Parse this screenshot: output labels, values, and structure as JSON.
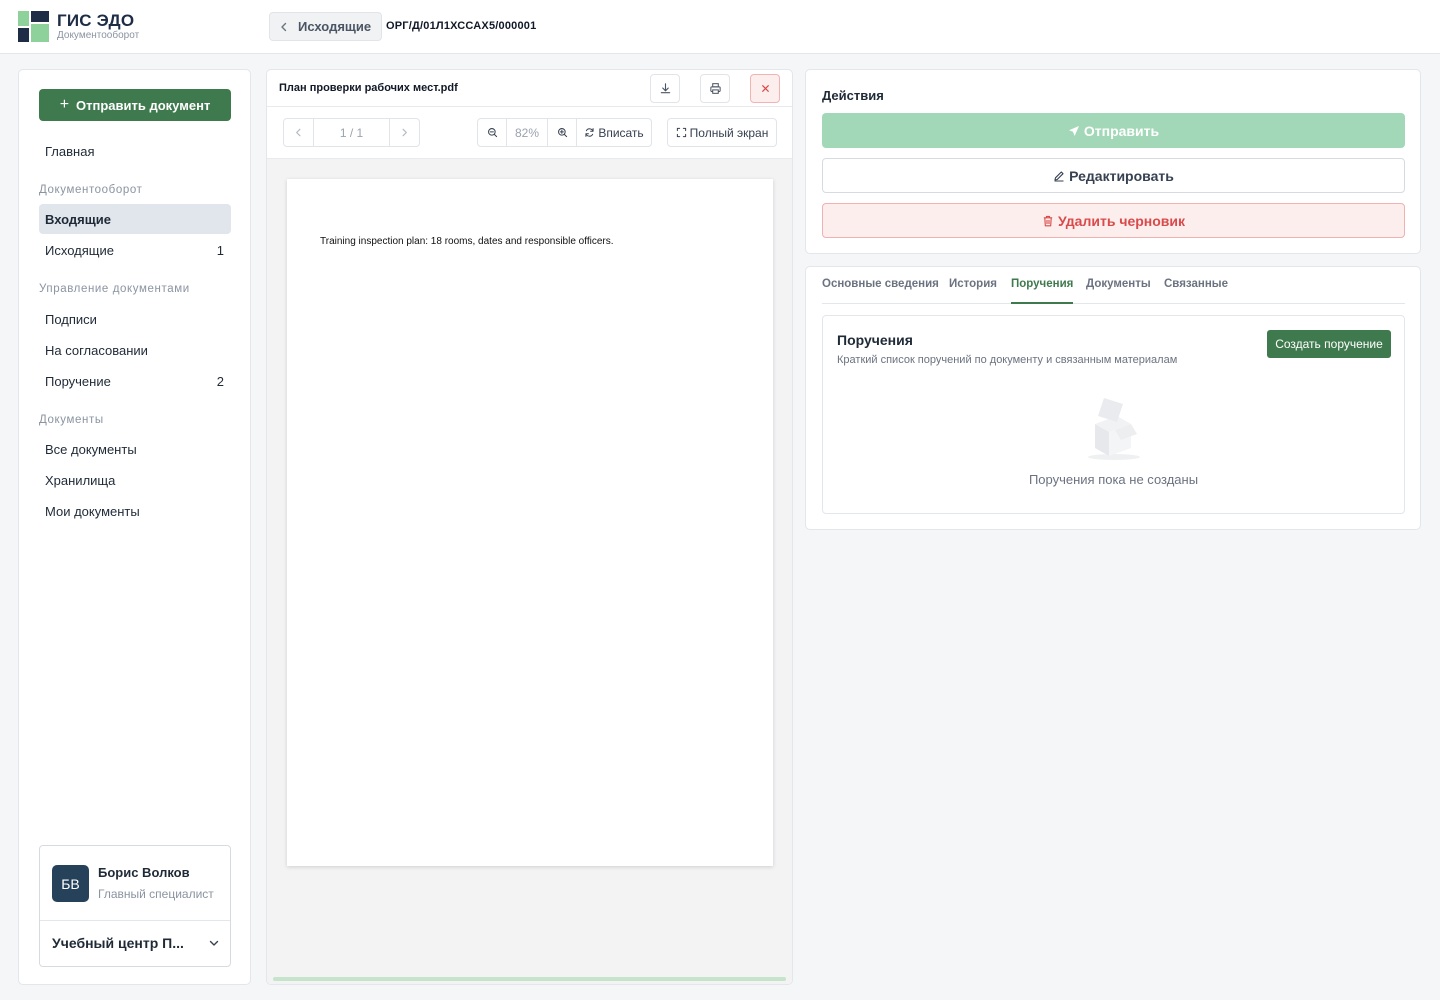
{
  "header": {
    "brand_title": "ГИС ЭДО",
    "brand_subtitle": "Документооборот",
    "back_label": "Исходящие",
    "doc_number": "ОРГ/Д/01Л1ХССАХ5/000001"
  },
  "sidebar": {
    "send_label": "Отправить документ",
    "home_label": "Главная",
    "sections": [
      {
        "title": "Документооборот"
      },
      {
        "title": "Управление документами"
      },
      {
        "title": "Документы"
      }
    ],
    "items": [
      {
        "label": "Входящие",
        "count": ""
      },
      {
        "label": "Исходящие",
        "count": "1"
      },
      {
        "label": "Подписи",
        "count": ""
      },
      {
        "label": "На согласовании",
        "count": ""
      },
      {
        "label": "Поручение",
        "count": "2"
      },
      {
        "label": "Все документы",
        "count": ""
      },
      {
        "label": "Хранилища",
        "count": ""
      },
      {
        "label": "Мои документы",
        "count": ""
      }
    ],
    "user": {
      "initials": "БВ",
      "name": "Борис Волков",
      "role": "Главный специалист",
      "org": "Учебный центр П..."
    }
  },
  "viewer": {
    "file_name": "План проверки рабочих мест.pdf",
    "page_indicator": "1 / 1",
    "zoom": "82%",
    "fit_label": "Вписать",
    "fullscreen_label": "Полный экран",
    "page_text": "Training inspection plan: 18 rooms, dates and responsible officers.",
    "progress_percent": 100
  },
  "actions": {
    "title": "Действия",
    "send": "Отправить",
    "edit": "Редактировать",
    "delete": "Удалить черновик"
  },
  "details": {
    "tabs": [
      "Основные сведения",
      "История",
      "Поручения",
      "Документы",
      "Связанные"
    ],
    "active_tab": "Поручения",
    "card_title": "Поручения",
    "card_subtitle": "Краткий список поручений по документу и связанным материалам",
    "create_label": "Создать поручение",
    "empty_text": "Поручения пока не созданы"
  },
  "colors": {
    "accent": "#3f7a4e",
    "accent_light": "#a2d8b7",
    "danger": "#d94a4a",
    "brand_dark": "#1e2d45"
  }
}
